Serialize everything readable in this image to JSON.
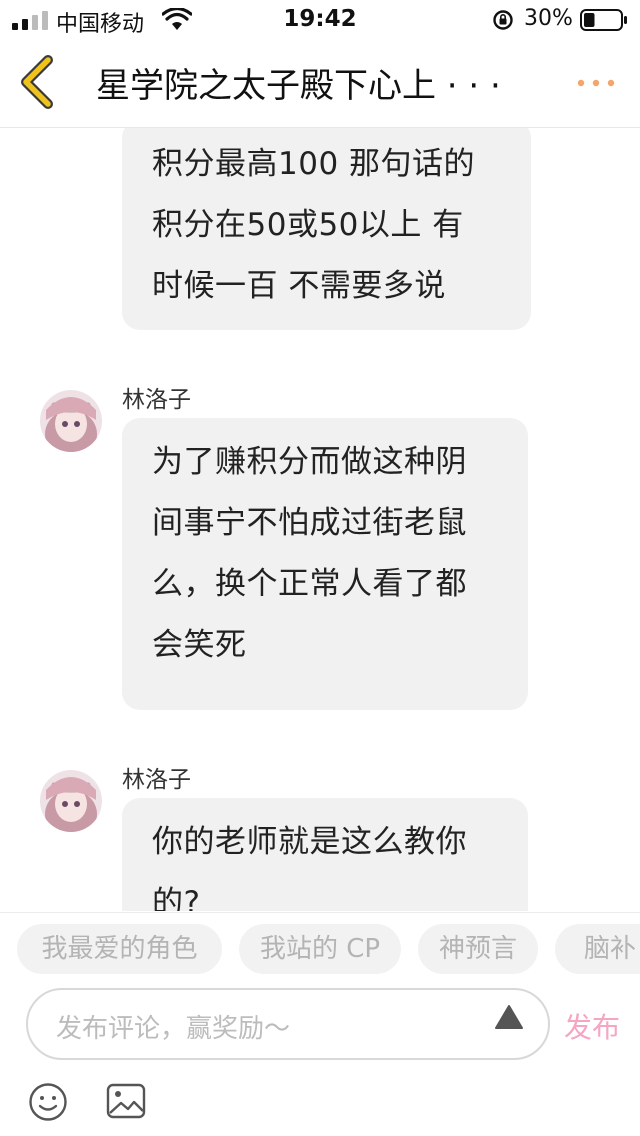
{
  "status_bar": {
    "carrier": "中国移动",
    "time": "19:42",
    "battery": "30%",
    "battery_level": 0.3
  },
  "nav": {
    "title": "星学院之太子殿下心上 · · ·",
    "back_icon": "chevron-left-icon",
    "more_icon": "more-dots-icon"
  },
  "messages": [
    {
      "sender": "",
      "lines": [
        "积分最高100 那句话的",
        "积分在50或50以上 有",
        "时候一百 不需要多说"
      ]
    },
    {
      "sender": "林洛子",
      "lines": [
        "为了赚积分而做这种阴",
        "间事宁不怕成过街老鼠",
        "么，换个正常人看了都",
        "会笑死"
      ]
    },
    {
      "sender": "林洛子",
      "lines": [
        "你的老师就是这么教你",
        "的?"
      ]
    }
  ],
  "tags": [
    "我最爱的角色",
    "我站的 CP",
    "神预言",
    "脑补"
  ],
  "comment": {
    "placeholder": "发布评论，赢奖励～",
    "publish_label": "发布"
  },
  "colors": {
    "accent_orange": "#f5a46a",
    "back_yellow": "#f0c21c",
    "publish_pink": "#f4a6c2",
    "bubble_bg": "#f1f1f1"
  }
}
